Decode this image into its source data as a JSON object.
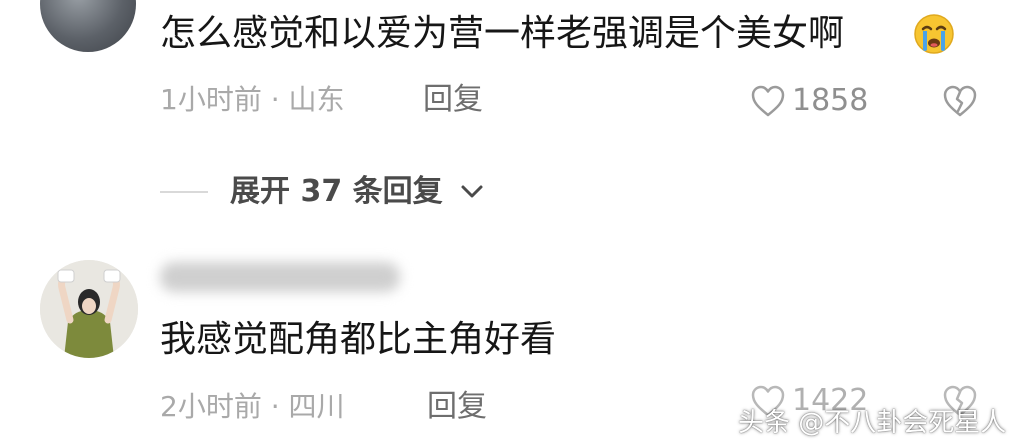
{
  "comments": [
    {
      "text": "怎么感觉和以爱为营一样老强调是个美女啊",
      "emoji": "cry-emoji",
      "time_location": "1小时前 · 山东",
      "reply_label": "回复",
      "like_count": "1858"
    },
    {
      "text": "我感觉配角都比主角好看",
      "time_location": "2小时前 · 四川",
      "reply_label": "回复",
      "like_count": "1422"
    }
  ],
  "expand_replies_label": "展开 37 条回复",
  "watermark": "头条 @不八卦会死星人",
  "colors": {
    "comment_text": "#161616",
    "meta_text": "#a9a9a9",
    "icon_stroke": "#9b9b9b",
    "emoji_face": "#f7c531",
    "emoji_tear": "#4aa3e8"
  }
}
